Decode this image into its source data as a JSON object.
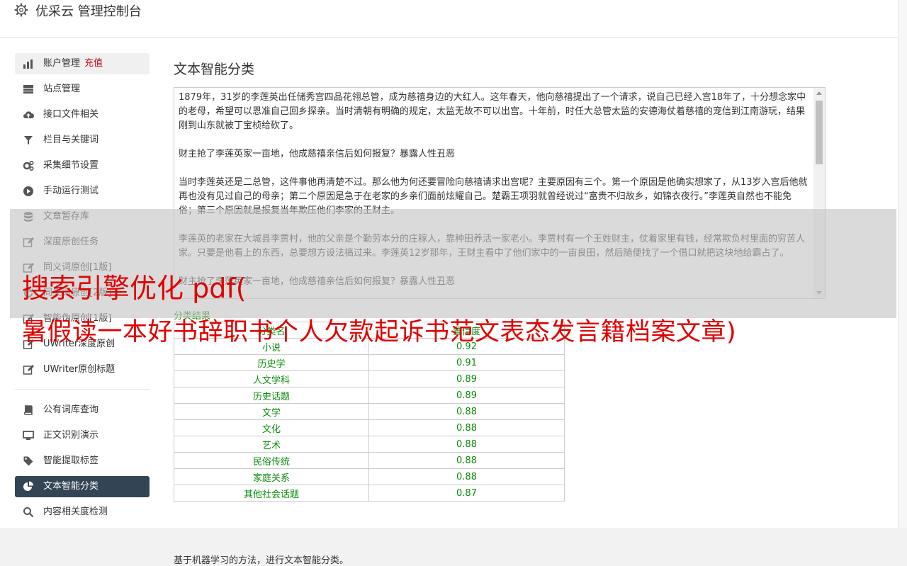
{
  "app": {
    "title": "优采云 管理控制台"
  },
  "sidebar": {
    "group1": [
      {
        "label": "账户管理",
        "extra": "充值",
        "icon": "bar-chart-icon",
        "name": "sidebar-item-account"
      },
      {
        "label": "站点管理",
        "icon": "server-icon",
        "name": "sidebar-item-sites"
      },
      {
        "label": "接口文件相关",
        "icon": "cloud-upload-icon",
        "name": "sidebar-item-interface"
      },
      {
        "label": "栏目与关键词",
        "icon": "filter-icon",
        "name": "sidebar-item-columns"
      },
      {
        "label": "采集细节设置",
        "icon": "gears-icon",
        "name": "sidebar-item-collect"
      },
      {
        "label": "手动运行测试",
        "icon": "play-circle-icon",
        "name": "sidebar-item-manual-run"
      },
      {
        "label": "文章暂存库",
        "icon": "database-icon",
        "name": "sidebar-item-article-store"
      },
      {
        "label": "深度原创任务",
        "icon": "edit-icon",
        "name": "sidebar-item-deep-original"
      },
      {
        "label": "同义词原创[1版]",
        "icon": "edit-icon",
        "name": "sidebar-item-synonym-v1"
      },
      {
        "label": "同义词原创[2版]",
        "icon": "refresh-icon",
        "name": "sidebar-item-synonym-v2"
      },
      {
        "label": "智能伪原创[1版]",
        "icon": "edit-icon",
        "name": "sidebar-item-smart-v1"
      },
      {
        "label": "UWriter深度原创",
        "icon": "edit-icon",
        "name": "sidebar-item-uwriter-deep"
      },
      {
        "label": "UWriter原创标题",
        "icon": "edit-icon",
        "name": "sidebar-item-uwriter-title"
      }
    ],
    "group2": [
      {
        "label": "公有词库查询",
        "icon": "book-icon",
        "name": "sidebar-item-public-lexicon"
      },
      {
        "label": "正文识别演示",
        "icon": "monitor-icon",
        "name": "sidebar-item-text-recognition"
      },
      {
        "label": "智能提取标签",
        "icon": "tag-icon",
        "name": "sidebar-item-extract-tags"
      },
      {
        "label": "文本智能分类",
        "icon": "pie-chart-icon",
        "name": "sidebar-item-text-classify",
        "active": true
      },
      {
        "label": "内容相关度检测",
        "icon": "search-icon",
        "name": "sidebar-item-relevance"
      }
    ]
  },
  "main": {
    "title": "文本智能分类",
    "paragraphs": [
      "1879年，31岁的李莲英出任储秀宫四品花翎总管，成为慈禧身边的大红人。这年春天，他向慈禧提出了一个请求，说自己已经入宫18年了，十分想念家中的老母，希望可以恩准自己回乡探亲。当时清朝有明确的规定，太监无故不可以出宫。十年前，时任大总管太监的安德海仗着慈禧的宠信到江南游玩，结果刚到山东就被丁宝桢给砍了。",
      "财主抢了李莲英家一亩地，他成慈禧亲信后如何报复？暴露人性丑恶",
      "当时李莲英还是二总管，这件事他再清楚不过。那么他为何还要冒险向慈禧请求出宫呢？主要原因有三个。第一个原因是他确实想家了，从13岁入宫后他就再也没有见过自己的母亲；第二个原因是急于在老家的乡亲们面前炫耀自己。楚霸王项羽就曾经说过“富贵不归故乡，如锦衣夜行。”李莲英自然也不能免俗；第三个原因就是报复当年欺压他们李家的王财主。",
      "李莲英的老家在大城县李贾村，他的父亲是个勤劳本分的庄稼人，靠种田养活一家老小。李贾村有一个王姓财主，仗着家里有钱，经常欺负村里面的穷苦人家。只要是他看上的东西，总要想方设法搞过来。李莲英12岁那年，王财主看中了他们家中的一亩良田，然后随便找了一个借口就把这块地给霸占了。",
      "财主抢了李莲英家一亩地，他成慈禧亲信后如何报复？暴露人性丑恶"
    ],
    "result_label": "分类结果",
    "table_headers": [
      "分类名",
      "置信度"
    ],
    "rows": [
      [
        "小说",
        "0.92"
      ],
      [
        "历史学",
        "0.91"
      ],
      [
        "人文学科",
        "0.89"
      ],
      [
        "历史话题",
        "0.89"
      ],
      [
        "文学",
        "0.88"
      ],
      [
        "文化",
        "0.88"
      ],
      [
        "艺术",
        "0.88"
      ],
      [
        "民俗传统",
        "0.88"
      ],
      [
        "家庭关系",
        "0.88"
      ],
      [
        "其他社会话题",
        "0.87"
      ]
    ],
    "footnote": "基于机器学习的方法，进行文本智能分类。"
  },
  "overlay": {
    "line1": "搜索引擎优化 pdf(",
    "line2": "暑假读一本好书辞职书个人欠款起诉书范文表态发言籍档案文章)"
  },
  "colors": {
    "active_bg": "#334455",
    "result_green": "#0a8a0a",
    "overlay_red": "#e00000",
    "recharge_red": "#d0021b"
  }
}
